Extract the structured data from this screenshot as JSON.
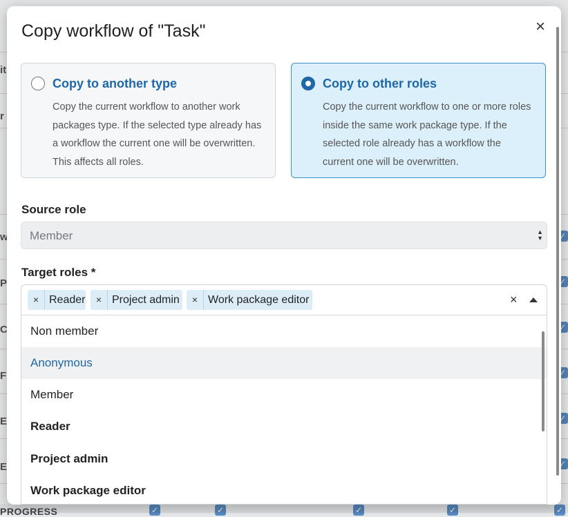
{
  "background": {
    "fragments": [
      "it",
      "r",
      "w",
      "PI",
      "CI",
      "F",
      "E",
      "EI"
    ],
    "bottom_row_text": "PROGRESS",
    "check_glyph": "✓"
  },
  "modal": {
    "title": "Copy workflow of \"Task\"",
    "close_glyph": "×"
  },
  "options": {
    "copy_type": {
      "title": "Copy to another type",
      "description": "Copy the current workflow to another work packages type. If the selected type already has a workflow the current one will be overwritten. This affects all roles.",
      "selected": false
    },
    "copy_roles": {
      "title": "Copy to other roles",
      "description": "Copy the current workflow to one or more roles inside the same work package type. If the selected role already has a workflow the current one will be overwritten.",
      "selected": true
    }
  },
  "source_role": {
    "label": "Source role",
    "value": "Member",
    "arrows_glyph": "▲▼"
  },
  "target_roles": {
    "label": "Target roles *",
    "tag_remove_glyph": "×",
    "clear_glyph": "×",
    "tags": [
      "Reader",
      "Project admin",
      "Work package editor"
    ],
    "options": [
      {
        "label": "Non member",
        "selected": false,
        "hovered": false
      },
      {
        "label": "Anonymous",
        "selected": false,
        "hovered": true
      },
      {
        "label": "Member",
        "selected": false,
        "hovered": false
      },
      {
        "label": "Reader",
        "selected": true,
        "hovered": false
      },
      {
        "label": "Project admin",
        "selected": true,
        "hovered": false
      },
      {
        "label": "Work package editor",
        "selected": true,
        "hovered": false
      }
    ]
  },
  "colors": {
    "accent": "#1f67a6",
    "selected_card_bg": "#dcf0fb",
    "tag_bg": "#dcedf8"
  }
}
